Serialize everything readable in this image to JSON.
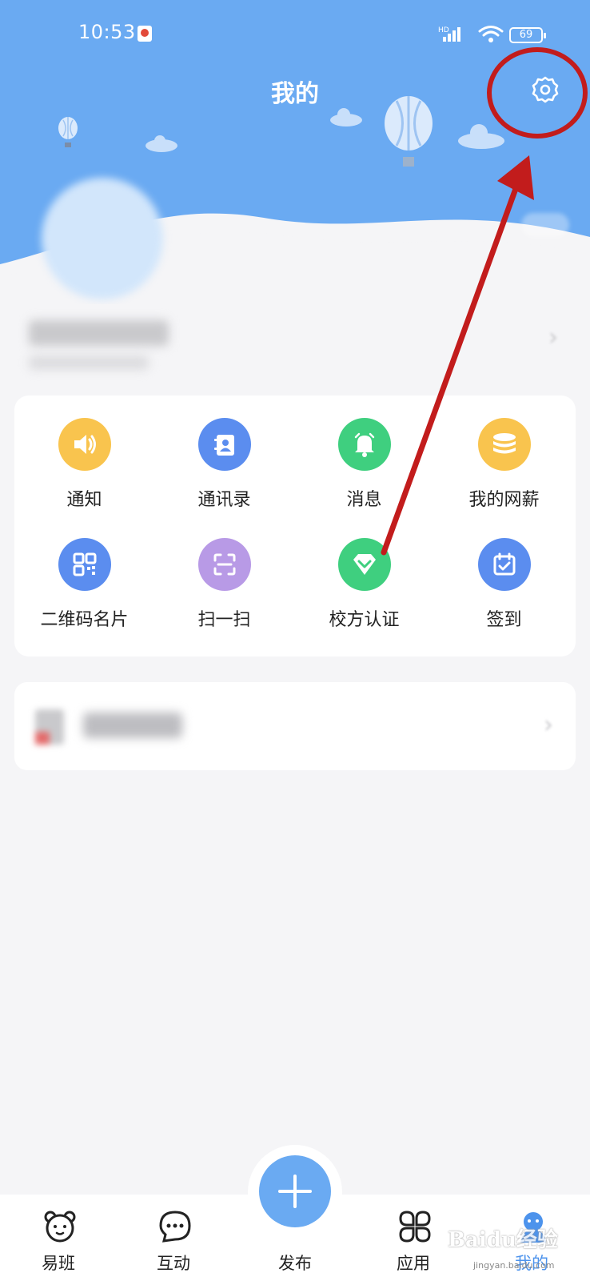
{
  "status_bar": {
    "time": "10:53",
    "network": "HD",
    "battery": "69"
  },
  "header": {
    "title": "我的",
    "settings_icon": "gear-icon"
  },
  "features": [
    {
      "label": "通知",
      "icon": "speaker-icon",
      "color": "#f9c44e"
    },
    {
      "label": "通讯录",
      "icon": "contacts-icon",
      "color": "#5b8def"
    },
    {
      "label": "消息",
      "icon": "bell-icon",
      "color": "#3fcf7f"
    },
    {
      "label": "我的网薪",
      "icon": "coins-icon",
      "color": "#f9c44e"
    },
    {
      "label": "二维码名片",
      "icon": "qr-code-icon",
      "color": "#5b8def"
    },
    {
      "label": "扫一扫",
      "icon": "scan-icon",
      "color": "#b89ae6"
    },
    {
      "label": "校方认证",
      "icon": "diamond-icon",
      "color": "#3fcf7f"
    },
    {
      "label": "签到",
      "icon": "calendar-check-icon",
      "color": "#5b8def"
    }
  ],
  "bottom_nav": [
    {
      "label": "易班",
      "icon": "bear-face-icon",
      "active": false
    },
    {
      "label": "互动",
      "icon": "chat-bubble-icon",
      "active": false
    },
    {
      "label": "发布",
      "icon": "plus-icon",
      "active": false
    },
    {
      "label": "应用",
      "icon": "four-leaf-icon",
      "active": false
    },
    {
      "label": "我的",
      "icon": "person-icon",
      "active": true
    }
  ],
  "watermark": {
    "text": "Baidu经验",
    "sub": "jingyan.baidu.com"
  },
  "colors": {
    "header_bg": "#6aaaf2",
    "accent": "#4d93ec",
    "annotation": "#c21c1c"
  }
}
